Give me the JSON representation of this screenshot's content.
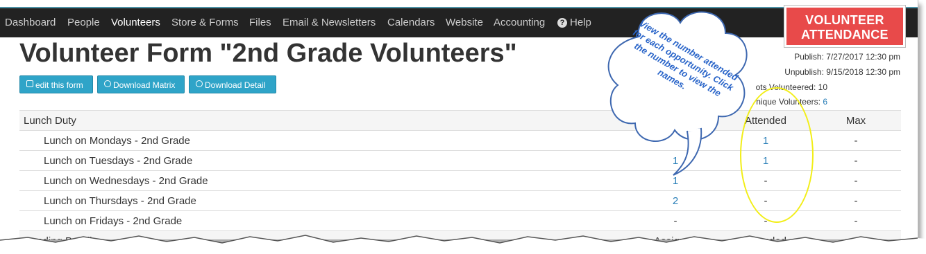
{
  "nav": {
    "items": [
      "Dashboard",
      "People",
      "Volunteers",
      "Store & Forms",
      "Files",
      "Email & Newsletters",
      "Calendars",
      "Website",
      "Accounting"
    ],
    "help": "Help",
    "active": "Volunteers"
  },
  "badge": {
    "line1": "VOLUNTEER",
    "line2": "ATTENDANCE",
    "color": "#e84a4a"
  },
  "page": {
    "title": "Volunteer Form \"2nd Grade Volunteers\""
  },
  "buttons": {
    "edit": "edit this form",
    "matrix": "Download Matrix",
    "detail": "Download Detail"
  },
  "meta": {
    "publish": "Publish: 7/27/2017 12:30 pm",
    "unpublish": "Unpublish: 9/15/2018 12:30 pm",
    "slots_label": "ots Volunteered:",
    "slots_value": "10",
    "unique_label": "nique Volunteers:",
    "unique_value": "6"
  },
  "callout": {
    "text": "View the number attended for each opportunity. Click the number to view the names."
  },
  "table": {
    "group": "Lunch Duty",
    "headers": {
      "attended": "Attended",
      "max": "Max"
    },
    "rows": [
      {
        "name": "Lunch on Mondays - 2nd Grade",
        "assigned": "",
        "attended": "1",
        "max": "-"
      },
      {
        "name": "Lunch on Tuesdays - 2nd Grade",
        "assigned": "1",
        "attended": "1",
        "max": "-"
      },
      {
        "name": "Lunch on Wednesdays - 2nd Grade",
        "assigned": "1",
        "attended": "-",
        "max": "-"
      },
      {
        "name": "Lunch on Thursdays - 2nd Grade",
        "assigned": "2",
        "attended": "-",
        "max": "-"
      },
      {
        "name": "Lunch on Fridays - 2nd Grade",
        "assigned": "-",
        "attended": "-",
        "max": "-"
      }
    ],
    "next_group": "Reading Buddies",
    "next_headers": {
      "assigned": "Assigned",
      "attended": "Attended"
    }
  },
  "colors": {
    "accent": "#2fa4c8",
    "link": "#2a7fb8",
    "highlight": "#f2ee18",
    "navbar": "#222222"
  }
}
